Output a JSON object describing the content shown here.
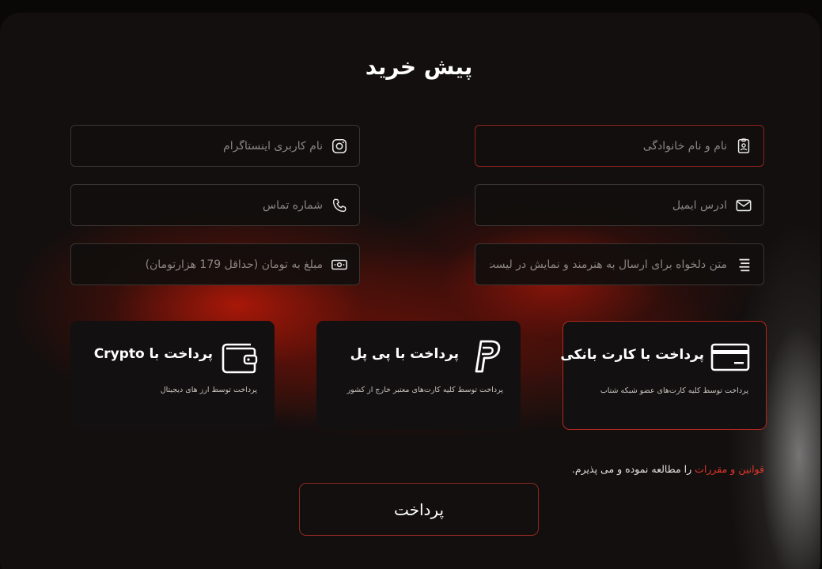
{
  "page": {
    "title": "پیش خرید"
  },
  "form": {
    "full_name": {
      "placeholder": "نام و نام خانوادگی",
      "value": "",
      "icon": "id-badge-icon"
    },
    "instagram": {
      "placeholder": "نام کاربری اینستاگرام",
      "value": "",
      "icon": "instagram-icon"
    },
    "email": {
      "placeholder": "ادرس ایمیل",
      "value": "",
      "icon": "envelope-icon"
    },
    "phone": {
      "placeholder": "شماره تماس",
      "value": "",
      "icon": "phone-icon"
    },
    "message": {
      "placeholder": "متن دلخواه برای ارسال به هنرمند و نمایش در لیست",
      "value": "",
      "icon": "text-lines-icon"
    },
    "amount": {
      "placeholder": "مبلغ به تومان (حداقل 179 هزارتومان)",
      "value": "",
      "icon": "cash-icon"
    }
  },
  "payment_methods": [
    {
      "id": "bank_card",
      "title": "پرداخت با کارت بانکی",
      "description": "پرداخت توسط کلیه کارت‌های عضو شبکه شتاب",
      "icon": "credit-card-icon",
      "selected": true
    },
    {
      "id": "paypal",
      "title": "پرداخت با پی پل",
      "description": "پرداخت توسط کلیه کارت‌های معتبر خارج از کشور",
      "icon": "paypal-icon",
      "selected": false
    },
    {
      "id": "crypto",
      "title": "پرداخت با Crypto",
      "description": "پرداخت توسط ارز های دیجیتال",
      "icon": "wallet-icon",
      "selected": false
    }
  ],
  "terms": {
    "link_text": "قوانین و مقررات",
    "rest_text": " را مطالعه نموده و می پذیرم."
  },
  "submit_label": "پرداخت",
  "colors": {
    "accent_red": "#e0352a",
    "selected_border": "#b3271d",
    "field_border": "#3a3532",
    "background": "#120f0e"
  }
}
